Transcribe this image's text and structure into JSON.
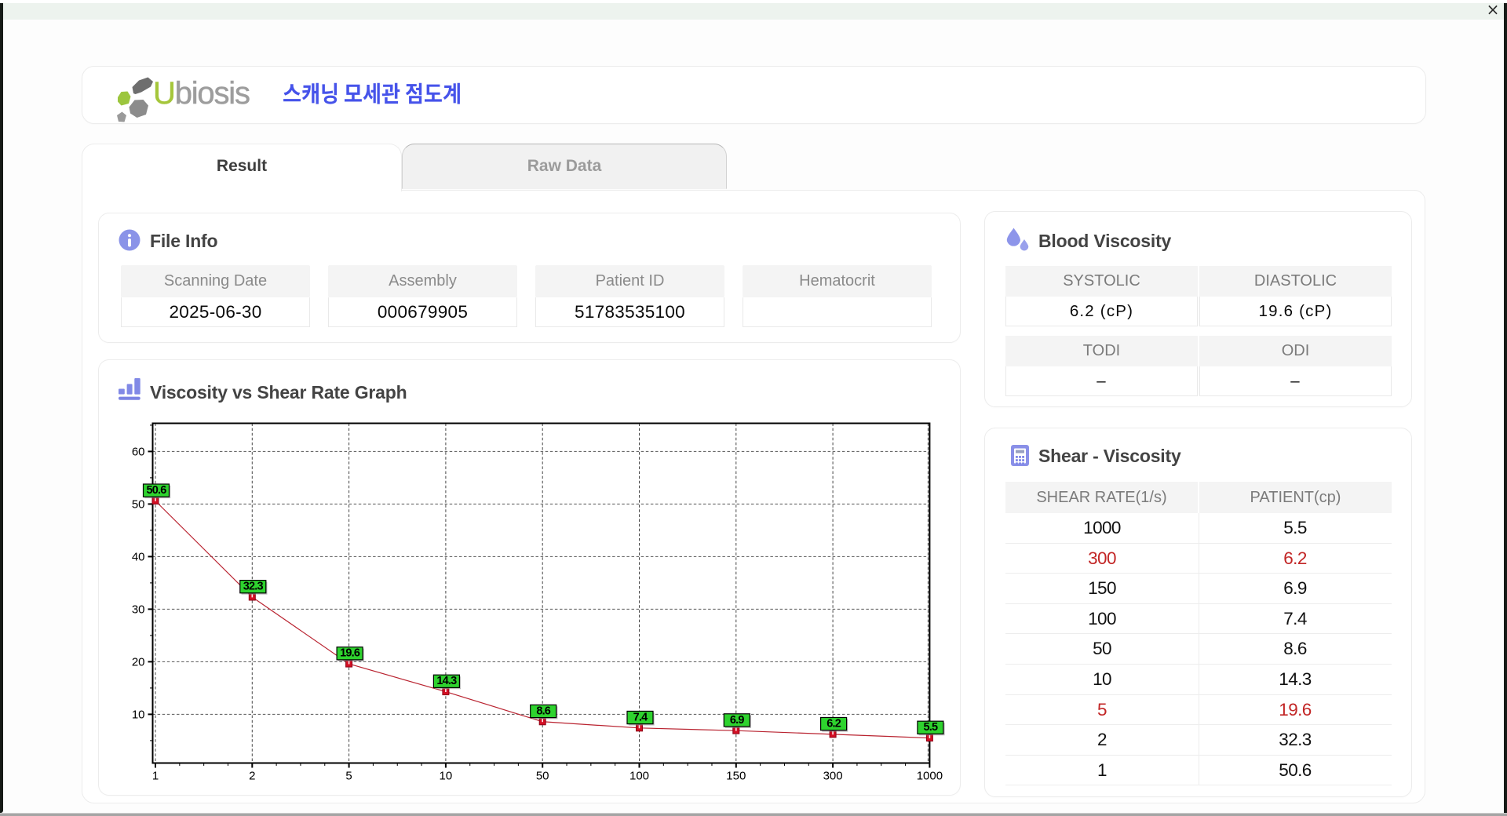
{
  "window": {
    "close_label": "×"
  },
  "header": {
    "brand_first_letter": "U",
    "brand_rest": "biosis",
    "app_title_korean": "스캐닝 모세관 점도계"
  },
  "tabs": [
    {
      "label": "Result",
      "active": true
    },
    {
      "label": "Raw Data",
      "active": false
    }
  ],
  "file_info": {
    "title": "File Info",
    "fields": [
      {
        "label": "Scanning Date",
        "value": "2025-06-30"
      },
      {
        "label": "Assembly",
        "value": "000679905"
      },
      {
        "label": "Patient ID",
        "value": "51783535100"
      },
      {
        "label": "Hematocrit",
        "value": ""
      }
    ]
  },
  "graph_section": {
    "title": "Viscosity vs Shear Rate Graph"
  },
  "blood_viscosity": {
    "title": "Blood Viscosity",
    "table1": [
      {
        "label": "SYSTOLIC",
        "value": "6.2 (cP)"
      },
      {
        "label": "DIASTOLIC",
        "value": "19.6 (cP)"
      }
    ],
    "table2": [
      {
        "label": "TODI",
        "value": "–"
      },
      {
        "label": "ODI",
        "value": "–"
      }
    ]
  },
  "shear_viscosity": {
    "title": "Shear - Viscosity",
    "columns": [
      "SHEAR RATE(1/s)",
      "PATIENT(cp)"
    ],
    "rows": [
      {
        "shear_rate": "1000",
        "patient": "5.5",
        "highlight": false
      },
      {
        "shear_rate": "300",
        "patient": "6.2",
        "highlight": true
      },
      {
        "shear_rate": "150",
        "patient": "6.9",
        "highlight": false
      },
      {
        "shear_rate": "100",
        "patient": "7.4",
        "highlight": false
      },
      {
        "shear_rate": "50",
        "patient": "8.6",
        "highlight": false
      },
      {
        "shear_rate": "10",
        "patient": "14.3",
        "highlight": false
      },
      {
        "shear_rate": "5",
        "patient": "19.6",
        "highlight": true
      },
      {
        "shear_rate": "2",
        "patient": "32.3",
        "highlight": false
      },
      {
        "shear_rate": "1",
        "patient": "50.6",
        "highlight": false
      }
    ]
  },
  "chart_data": {
    "type": "line",
    "title": "Viscosity vs Shear Rate Graph",
    "categories": [
      1,
      2,
      5,
      10,
      50,
      100,
      150,
      300,
      1000
    ],
    "values": [
      50.6,
      32.3,
      19.6,
      14.3,
      8.6,
      7.4,
      6.9,
      6.2,
      5.5
    ],
    "xlabel": "",
    "ylabel": "",
    "x_axis_type": "categorical-log-like",
    "y_ticks": [
      10,
      20,
      30,
      40,
      50,
      60
    ],
    "ylim": [
      0.7,
      65.4
    ],
    "grid": "dashed",
    "legend": "none",
    "line_color": "#b92330",
    "marker_color": "#d40f24",
    "point_label_bg": "#2ed32e"
  },
  "colors": {
    "accent_periwinkle": "#8a92e8",
    "korean_title_blue": "#4653ea",
    "brand_green": "#a5c63b",
    "brand_gray": "#9d9d9d",
    "highlight_red": "#c22525",
    "titlebar_green": "#edf3ee"
  }
}
